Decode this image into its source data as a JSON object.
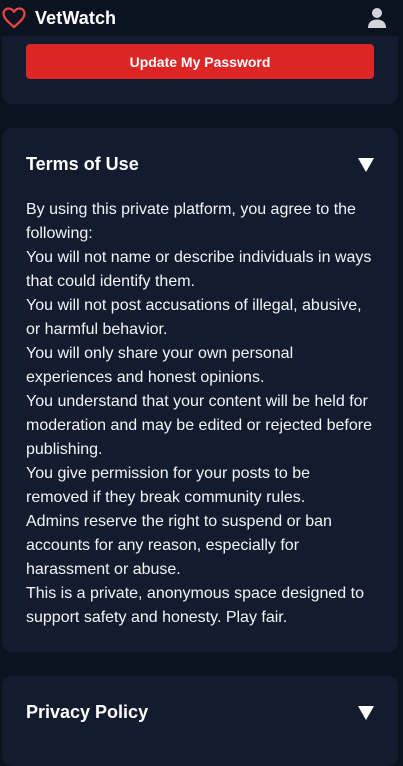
{
  "header": {
    "app_name": "VetWatch",
    "brand_icon": "heart-icon",
    "user_icon": "user-icon"
  },
  "password_section": {
    "button_label": "Update My Password"
  },
  "terms": {
    "title": "Terms of Use",
    "toggle_icon": "caret-down-icon",
    "lines": [
      "By using this private platform, you agree to the following:",
      "You will not name or describe individuals in ways that could identify them.",
      "You will not post accusations of illegal, abusive, or harmful behavior.",
      "You will only share your own personal experiences and honest opinions.",
      "You understand that your content will be held for moderation and may be edited or rejected before publishing.",
      "You give permission for your posts to be removed if they break community rules.",
      "Admins reserve the right to suspend or ban accounts for any reason, especially for harassment or abuse.",
      "This is a private, anonymous space designed to support safety and honesty. Play fair."
    ]
  },
  "privacy": {
    "title": "Privacy Policy",
    "toggle_icon": "caret-down-icon"
  },
  "colors": {
    "background": "#0b1220",
    "card": "#131c2e",
    "accent": "#dc2626",
    "text": "#ffffff"
  }
}
